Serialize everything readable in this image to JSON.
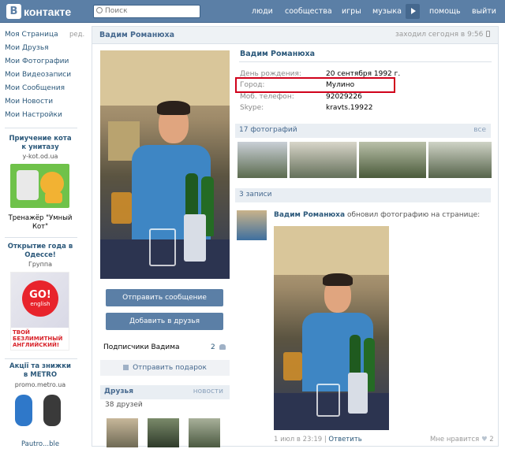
{
  "brand": {
    "logo_letter": "B",
    "logo_text": "контакте"
  },
  "search": {
    "placeholder": "Поиск"
  },
  "topnav": [
    "люди",
    "сообщества",
    "игры",
    "музыка",
    "помощь",
    "выйти"
  ],
  "leftnav": {
    "items": [
      "Моя Страница",
      "Мои Друзья",
      "Мои Фотографии",
      "Мои Видеозаписи",
      "Мои Сообщения",
      "Мои Новости",
      "Мои Настройки"
    ],
    "edit": "ред."
  },
  "ads": [
    {
      "title": "Приучение кота к унитазу",
      "sub": "y-kot.od.ua",
      "text": "Тренажёр \"Умный Кот\""
    },
    {
      "title": "Открытие года в Одессе!",
      "sub": "Группа",
      "badge": "GO!",
      "badge_sub": "english",
      "banner": "ТВОЙ БЕЗЛИМИТНЫЙ АНГЛИЙСКИЙ!"
    },
    {
      "title": "Акції та знижки в METRO",
      "sub": "promo.metro.ua",
      "text": "Pautro...ble"
    }
  ],
  "profile": {
    "name": "Вадим Романюха",
    "last_seen": "заходил сегодня в 9:56",
    "info": [
      {
        "label": "День рождения:",
        "value": "20 сентября 1992 г."
      },
      {
        "label": "Город:",
        "value": "Мулино"
      },
      {
        "label": "Моб. телефон:",
        "value": "92029226"
      },
      {
        "label": "Skype:",
        "value": "kravts.19922"
      }
    ],
    "highlight_color": "#d0021b"
  },
  "actions": {
    "send_message": "Отправить сообщение",
    "add_friend": "Добавить в друзья",
    "subscribers_label": "Подписчики Вадима",
    "subscribers_count": "2",
    "send_gift": "Отправить подарок"
  },
  "friends": {
    "title": "Друзья",
    "link": "новости",
    "count": "38 друзей"
  },
  "photos": {
    "title": "17 фотографий",
    "link": "все"
  },
  "wall": {
    "count": "3 записи",
    "author": "Вадим Романюха",
    "action": "обновил фотографию на странице:",
    "date": "1 июл в 23:19",
    "reply": "Ответить",
    "like": "Мне нравится",
    "likes": "2"
  },
  "colors": {
    "topbar": "#5b7fa6",
    "link": "#2b587a",
    "accent": "#45688e"
  }
}
